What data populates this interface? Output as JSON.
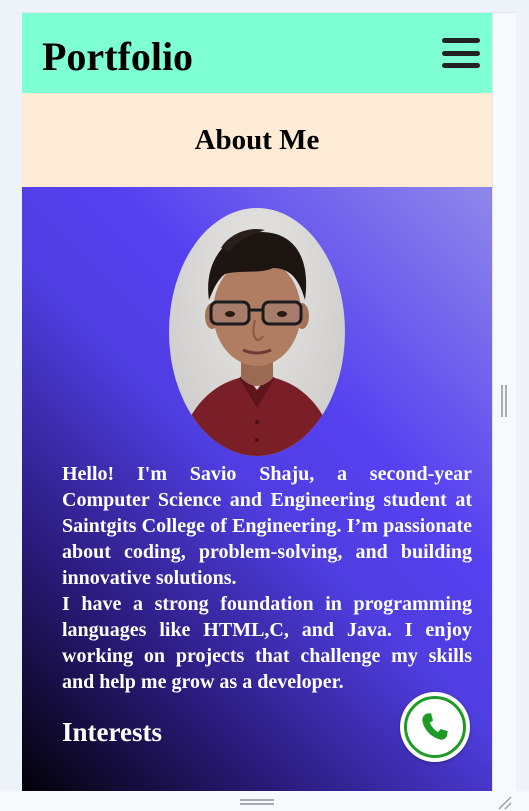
{
  "header": {
    "logo": "Portfolio",
    "menu_icon": "hamburger-menu-icon"
  },
  "section": {
    "title": "About Me"
  },
  "about": {
    "photo_alt": "Savio Shaju portrait",
    "paragraph_1": "Hello! I'm Savio Shaju, a second-year Computer Science and Engineering student at Saintgits College of Engineering. I’m passionate about coding, problem-solving, and building innovative solutions.",
    "paragraph_2": "I have a strong foundation in programming languages like HTML,C, and Java. I enjoy working on projects that challenge my skills and help me grow as a developer.",
    "interests_title": "Interests"
  },
  "call_button": {
    "icon": "phone-icon",
    "color": "#1e9b27"
  },
  "colors": {
    "header_bg": "#7fffd4",
    "section_bg": "#fdebd6",
    "gradient_start": "#000000",
    "gradient_mid": "#5540f0",
    "gradient_end": "#8f88ea"
  }
}
